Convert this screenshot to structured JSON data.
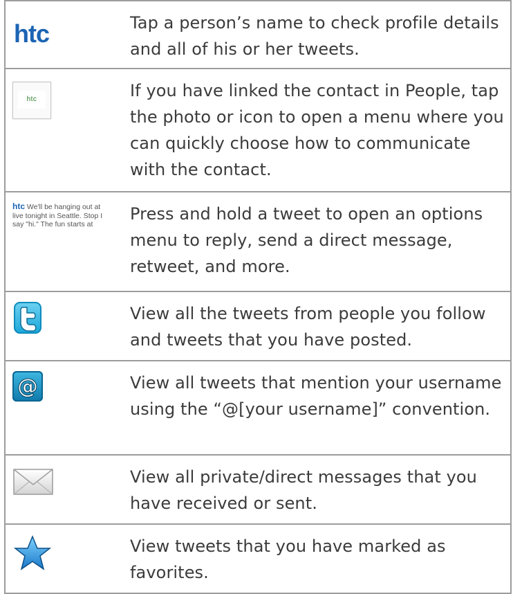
{
  "rows": [
    {
      "icon": "htc-logo-icon",
      "icon_text": "htc",
      "text": "Tap a person’s name to check profile details and all of his or her tweets."
    },
    {
      "icon": "contact-photo-icon",
      "icon_text": "htc",
      "text": "If you have linked the contact in People, tap the photo or icon to open a menu where you can quickly choose how to communicate with the contact."
    },
    {
      "icon": "tweet-preview-icon",
      "icon_text_brand": "htc",
      "icon_text_line1": " We'll be hanging out at",
      "icon_text_line2": "live tonight in Seattle. Stop I",
      "icon_text_line3": "say \"hi.\" The fun starts at",
      "text": "Press and hold a tweet to open an options menu to reply, send a direct message, retweet, and more."
    },
    {
      "icon": "twitter-bird-icon",
      "text": "View all the tweets from people you follow and tweets that you have posted."
    },
    {
      "icon": "at-mention-icon",
      "text": "View all tweets that mention your username using the “@[your username]” convention."
    },
    {
      "icon": "mail-envelope-icon",
      "text": "View all private/direct messages that you have received or sent."
    },
    {
      "icon": "favorite-star-icon",
      "text": "View tweets that you have marked as favorites."
    }
  ],
  "colors": {
    "border": "#9c9c9c",
    "text": "#3b3b3b",
    "htc_blue": "#1c64b4",
    "twitter_blue": "#1aa6d8"
  }
}
